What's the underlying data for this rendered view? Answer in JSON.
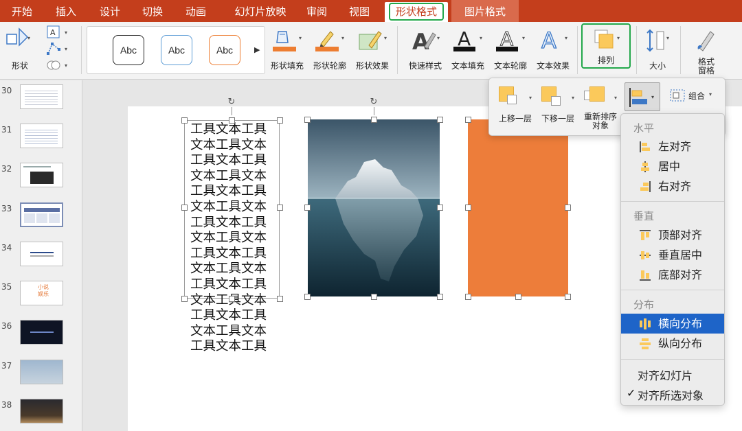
{
  "tabs": [
    {
      "label": "开始"
    },
    {
      "label": "插入"
    },
    {
      "label": "设计"
    },
    {
      "label": "切换"
    },
    {
      "label": "动画"
    },
    {
      "label": "幻灯片放映"
    },
    {
      "label": "审阅"
    },
    {
      "label": "视图"
    },
    {
      "label": "形状格式"
    },
    {
      "label": "图片格式"
    }
  ],
  "ribbon": {
    "shape_label": "形状",
    "style_samples": [
      "Abc",
      "Abc",
      "Abc"
    ],
    "shape_fill": "形状填充",
    "shape_outline": "形状轮廓",
    "shape_effects": "形状效果",
    "quick_styles": "快速样式",
    "text_fill": "文本填充",
    "text_outline": "文本轮廓",
    "text_effects": "文本效果",
    "arrange": "排列",
    "size": "大小",
    "format_pane": "格式\n窗格",
    "text_icon_a": "A"
  },
  "colors": {
    "tab_bar": "#c43e1c",
    "highlight": "#22a74a",
    "shape_orange": "#ed7d3a",
    "selected_item": "#1e64c8"
  },
  "slides": [
    {
      "num": "30"
    },
    {
      "num": "31"
    },
    {
      "num": "32"
    },
    {
      "num": "33"
    },
    {
      "num": "34"
    },
    {
      "num": "35",
      "thumb_text": "小说\n娱乐"
    },
    {
      "num": "36"
    },
    {
      "num": "37"
    },
    {
      "num": "38"
    }
  ],
  "textbox": {
    "content": "工具文本工具文本工具文本工具文本工具文本工具文本工具文本工具文本工具文本工具文本工具文本工具文本工具文本工具文本工具文本工具文本工具文本工具文本工具文本工具文本工具文本工具文本工具"
  },
  "arrange_popover": {
    "bring_forward": "上移一层",
    "send_backward": "下移一层",
    "reorder": "重新排序\n对象",
    "group": "组合"
  },
  "align_menu": {
    "horizontal_header": "水平",
    "left": "左对齐",
    "center": "居中",
    "right": "右对齐",
    "vertical_header": "垂直",
    "top": "顶部对齐",
    "middle": "垂直居中",
    "bottom": "底部对齐",
    "distribute_header": "分布",
    "distribute_h": "横向分布",
    "distribute_v": "纵向分布",
    "align_slide": "对齐幻灯片",
    "align_selected": "对齐所选对象"
  }
}
